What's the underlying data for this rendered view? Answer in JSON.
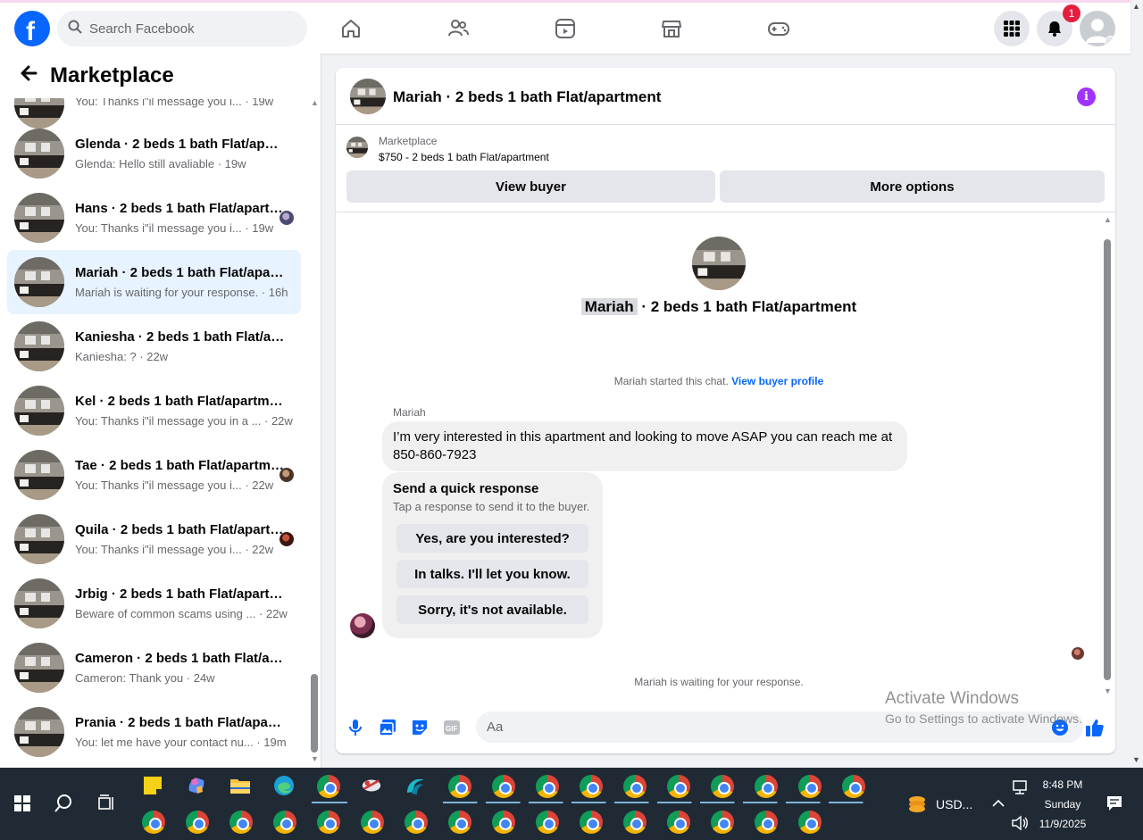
{
  "nav": {
    "search_placeholder": "Search Facebook",
    "notification_count": "1",
    "brand_color": "#0866ff"
  },
  "sidebar": {
    "title": "Marketplace",
    "partial_snippet": "You: Thanks i\"il message you i... · 19w",
    "conversations": [
      {
        "name": "Glenda · 2 beds 1 bath Flat/apartment",
        "snippet": "Glenda: Hello still avaliable · 19w"
      },
      {
        "name": "Hans · 2 beds 1 bath Flat/apartment",
        "snippet": "You: Thanks i\"il message you i... · 19w"
      },
      {
        "name": "Mariah · 2 beds 1 bath Flat/apartment",
        "snippet": "Mariah is waiting for your response. · 16h"
      },
      {
        "name": "Kaniesha · 2 beds 1 bath Flat/apartment",
        "snippet": "Kaniesha: ? · 22w"
      },
      {
        "name": "Kel · 2 beds 1 bath Flat/apartment",
        "snippet": "You: Thanks i\"il message you in a ... · 22w"
      },
      {
        "name": "Tae · 2 beds 1 bath Flat/apartment",
        "snippet": "You: Thanks i\"il message you i... · 22w"
      },
      {
        "name": "Quila · 2 beds 1 bath Flat/apartment",
        "snippet": "You: Thanks i\"il message you i... · 22w"
      },
      {
        "name": "Jrbig · 2 beds 1 bath Flat/apartment",
        "snippet": "Beware of common scams using ... · 22w"
      },
      {
        "name": "Cameron · 2 beds 1 bath Flat/apartment",
        "snippet": "Cameron: Thank you · 24w"
      },
      {
        "name": "Prania · 2 beds 1 bath Flat/apartment",
        "snippet": "You: let me have your contact nu... · 19m"
      }
    ]
  },
  "chat": {
    "title": "Mariah · 2 beds 1 bath Flat/apartment",
    "listing_source": "Marketplace",
    "listing_price": "$750 - 2 beds 1 bath Flat/apartment",
    "view_buyer": "View buyer",
    "more_options": "More options",
    "center_name": "Mariah",
    "center_rest": "· 2 beds 1 bath Flat/apartment",
    "started_text": "Mariah started this chat.",
    "view_buyer_profile": "View buyer profile",
    "sender": "Mariah",
    "message": "I’m very interested in this apartment and looking to move ASAP you can reach me at 850-860-7923",
    "quick_title": "Send a quick response",
    "quick_sub": "Tap a response to send it to the buyer.",
    "quick_options": [
      "Yes, are you interested?",
      "In talks. I'll let you know.",
      "Sorry, it's not available."
    ],
    "waiting": "Mariah is waiting for your response.",
    "composer_placeholder": "Aa"
  },
  "watermark": {
    "line1": "Activate Windows",
    "line2": "Go to Settings to activate Windows."
  },
  "taskbar": {
    "currency": "USD...",
    "time": "8:48 PM",
    "day": "Sunday",
    "date": "11/9/2025"
  }
}
